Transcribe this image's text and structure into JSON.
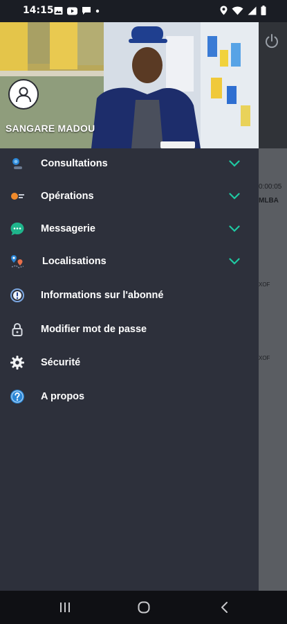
{
  "status_bar": {
    "time": "14:15",
    "left_icons": [
      "image-icon",
      "youtube-icon",
      "message-icon",
      "dot-icon"
    ],
    "right_icons": [
      "location-icon",
      "wifi-icon",
      "signal-icon",
      "battery-icon"
    ]
  },
  "drawer": {
    "user_name": "SANGARE MADOU",
    "items": [
      {
        "label": "Consultations",
        "icon": "search-user-icon",
        "expandable": true
      },
      {
        "label": "Opérations",
        "icon": "operations-icon",
        "expandable": true
      },
      {
        "label": "Messagerie",
        "icon": "chat-icon",
        "expandable": true
      },
      {
        "label": "Localisations",
        "icon": "location-pins-icon",
        "expandable": true
      },
      {
        "label": "Informations sur l'abonné",
        "icon": "info-icon",
        "expandable": false
      },
      {
        "label": "Modifier mot de passe",
        "icon": "lock-icon",
        "expandable": false
      },
      {
        "label": "Sécurité",
        "icon": "gear-icon",
        "expandable": false
      },
      {
        "label": "A propos",
        "icon": "help-icon",
        "expandable": false
      }
    ],
    "accent_color": "#1fc9a2"
  },
  "background_app": {
    "texts": [
      "0:00:05",
      "MLBA",
      "XOF",
      "XOF"
    ]
  },
  "nav_bar": {
    "buttons": [
      "recents-button",
      "home-button",
      "back-button"
    ]
  }
}
